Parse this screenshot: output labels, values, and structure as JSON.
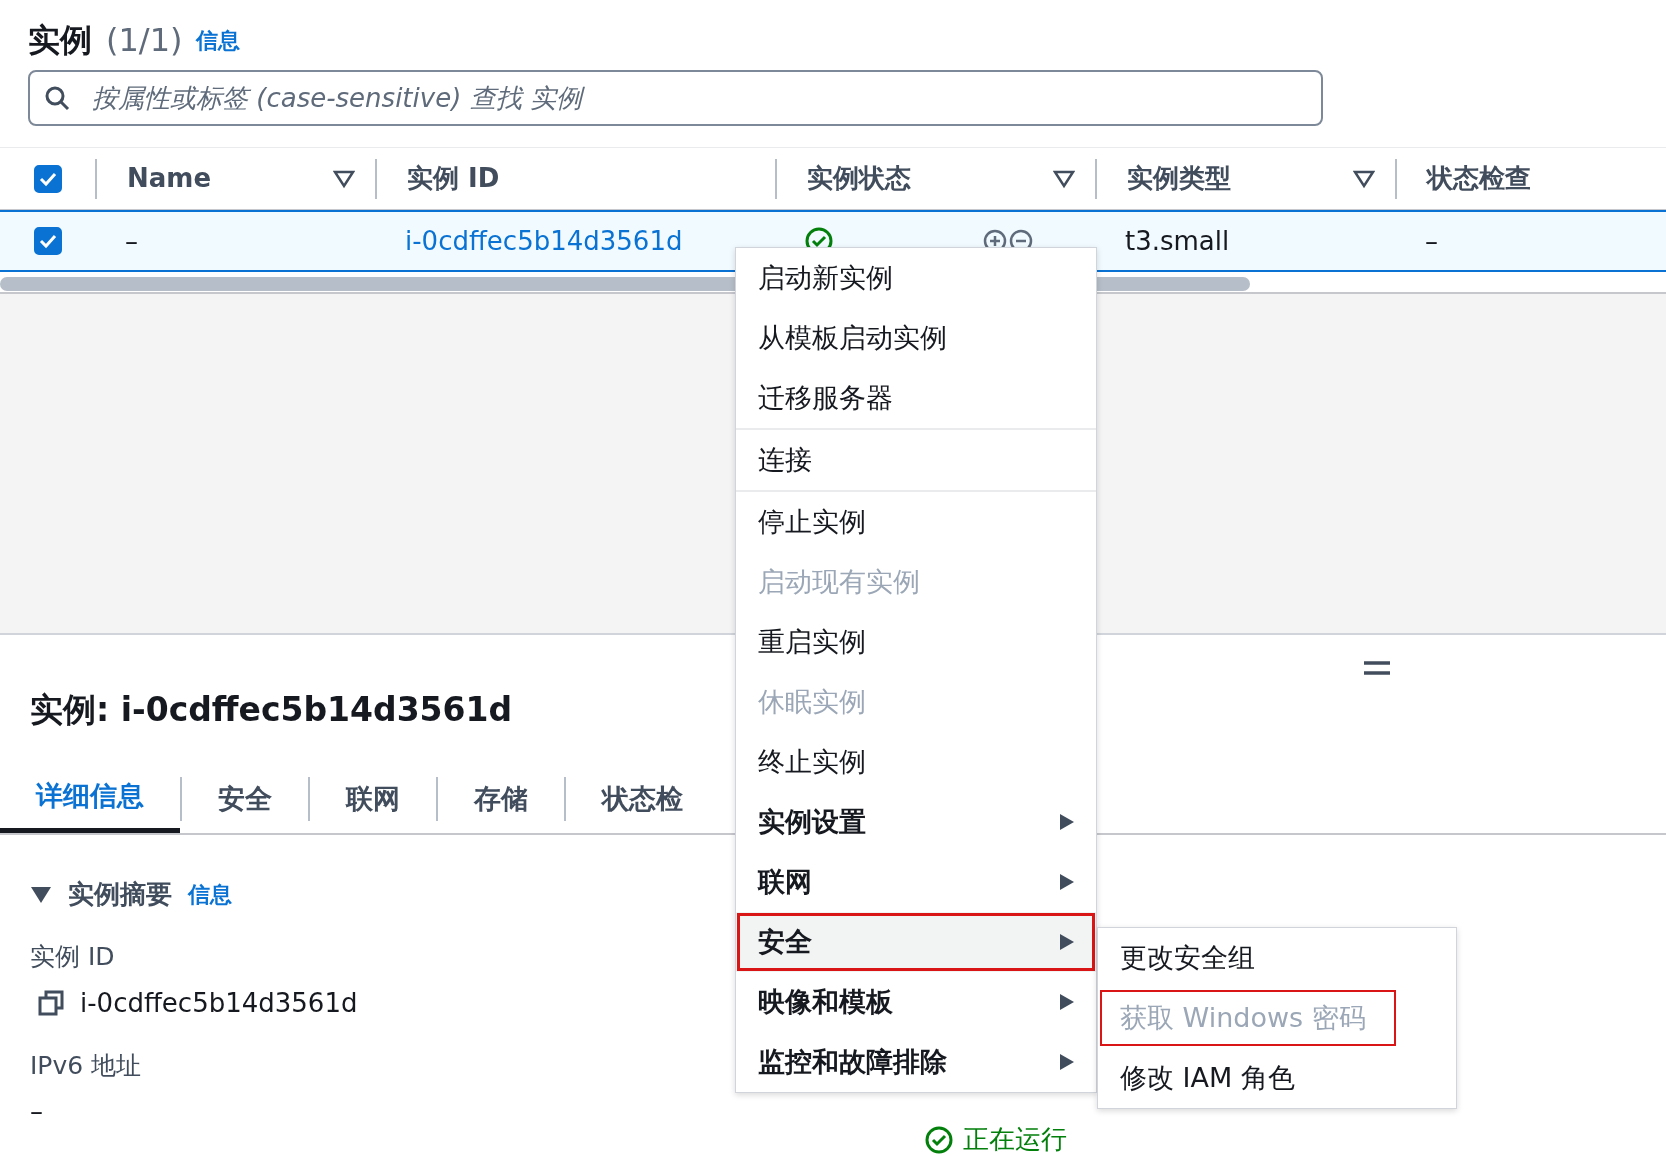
{
  "header": {
    "title": "实例",
    "count": "(1/1)",
    "info_link": "信息"
  },
  "search": {
    "placeholder": "按属性或标签 (case-sensitive) 查找 实例"
  },
  "table": {
    "select_all_checked": true,
    "columns": [
      {
        "label": "Name",
        "filter": true
      },
      {
        "label": "实例 ID",
        "filter": false
      },
      {
        "label": "实例状态",
        "filter": true
      },
      {
        "label": "实例类型",
        "filter": true
      },
      {
        "label": "状态检查",
        "filter": false
      }
    ],
    "rows": [
      {
        "selected": true,
        "name": "–",
        "instance_id": "i-0cdffec5b14d3561d",
        "type": "t3.small",
        "status_check": "–"
      }
    ]
  },
  "context_menu": {
    "groups": [
      [
        {
          "label": "启动新实例",
          "disabled": false,
          "has_submenu": false,
          "highlighted": false
        },
        {
          "label": "从模板启动实例",
          "disabled": false,
          "has_submenu": false,
          "highlighted": false
        },
        {
          "label": "迁移服务器",
          "disabled": false,
          "has_submenu": false,
          "highlighted": false
        }
      ],
      [
        {
          "label": "连接",
          "disabled": false,
          "has_submenu": false,
          "highlighted": false
        }
      ],
      [
        {
          "label": "停止实例",
          "disabled": false,
          "has_submenu": false,
          "highlighted": false
        },
        {
          "label": "启动现有实例",
          "disabled": true,
          "has_submenu": false,
          "highlighted": false
        },
        {
          "label": "重启实例",
          "disabled": false,
          "has_submenu": false,
          "highlighted": false
        },
        {
          "label": "休眠实例",
          "disabled": true,
          "has_submenu": false,
          "highlighted": false
        },
        {
          "label": "终止实例",
          "disabled": false,
          "has_submenu": false,
          "highlighted": false
        },
        {
          "label": "实例设置",
          "disabled": false,
          "has_submenu": true,
          "highlighted": false
        },
        {
          "label": "联网",
          "disabled": false,
          "has_submenu": true,
          "highlighted": false
        },
        {
          "label": "安全",
          "disabled": false,
          "has_submenu": true,
          "highlighted": true
        },
        {
          "label": "映像和模板",
          "disabled": false,
          "has_submenu": true,
          "highlighted": false
        },
        {
          "label": "监控和故障排除",
          "disabled": false,
          "has_submenu": true,
          "highlighted": false
        }
      ]
    ]
  },
  "submenu": [
    {
      "label": "更改安全组",
      "disabled": false,
      "highlighted": false
    },
    {
      "label": "获取 Windows 密码",
      "disabled": true,
      "highlighted": true
    },
    {
      "label": "修改 IAM 角色",
      "disabled": false,
      "highlighted": false
    }
  ],
  "detail": {
    "title": "实例: i-0cdffec5b14d3561d",
    "tabs": [
      {
        "label": "详细信息",
        "selected": true
      },
      {
        "label": "安全",
        "selected": false
      },
      {
        "label": "联网",
        "selected": false
      },
      {
        "label": "存储",
        "selected": false
      },
      {
        "label": "状态检",
        "selected": false
      }
    ],
    "section": {
      "title": "实例摘要",
      "expanded": true,
      "info_link": "信息"
    },
    "fields": [
      {
        "label": "实例 ID",
        "value": "i-0cdffec5b14d3561d",
        "copyable": true
      },
      {
        "label": "IPv6 地址",
        "value": "–",
        "copyable": false
      }
    ],
    "right_status": "正在运行"
  }
}
